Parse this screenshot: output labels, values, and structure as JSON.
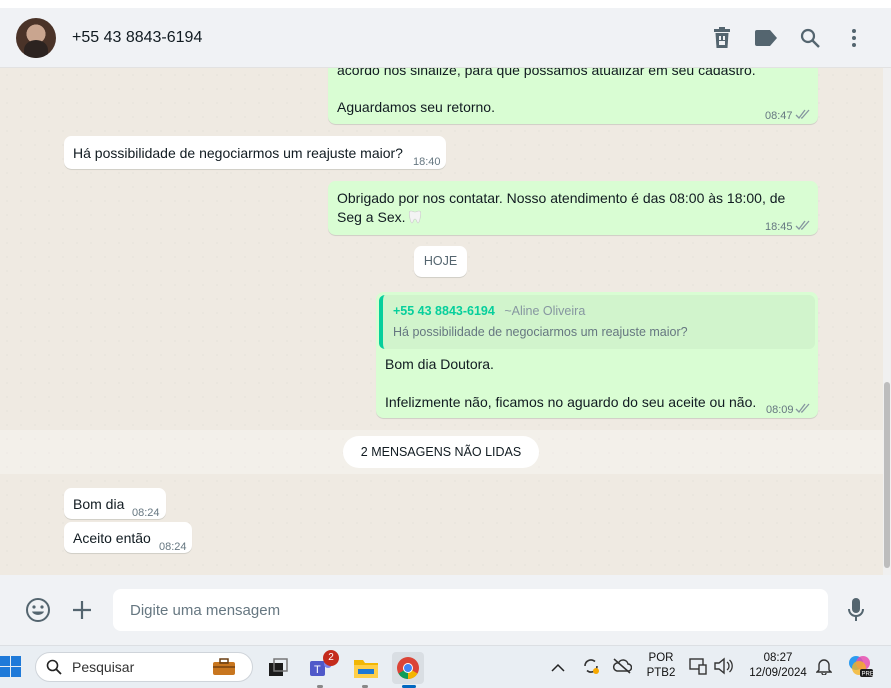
{
  "header": {
    "contact_name": "+55 43 8843-6194",
    "icons": [
      "delete-icon",
      "label-icon",
      "search-icon",
      "menu-icon"
    ]
  },
  "messages": {
    "m1_line1": "acordo nos sinalize, para que possamos atualizar em seu cadastro.",
    "m1_line2": "Aguardamos seu retorno.",
    "m1_time": "08:47",
    "m2_text": "Há possibilidade de negociarmos um reajuste maior?",
    "m2_time": "18:40",
    "m3_line1": "Obrigado por nos contatar. Nosso atendimento é das 08:00 às 18:00, de",
    "m3_line2": "Seg a Sex.",
    "m3_time": "18:45",
    "date_divider": "HOJE",
    "m4_quote_author": "+55 43 8843-6194",
    "m4_quote_pushname": "~Aline Oliveira",
    "m4_quote_text": "Há possibilidade de negociarmos um reajuste maior?",
    "m4_line1": "Bom dia Doutora.",
    "m4_line2": "Infelizmente não, ficamos no aguardo do seu aceite ou não.",
    "m4_time": "08:09",
    "unread_label": "2 MENSAGENS NÃO LIDAS",
    "m5_text": "Bom dia",
    "m5_time": "08:24",
    "m6_text": "Aceito então",
    "m6_time": "08:24"
  },
  "footer": {
    "placeholder": "Digite uma mensagem"
  },
  "taskbar": {
    "search_label": "Pesquisar",
    "teams_badge": "2",
    "lang_line1": "POR",
    "lang_line2": "PTB2",
    "time": "08:27",
    "date": "12/09/2024"
  },
  "colors": {
    "outgoing_bubble": "#d9fdd3",
    "incoming_bubble": "#ffffff",
    "quote_accent": "#06cf9c",
    "read_ticks": "#8696a0"
  }
}
